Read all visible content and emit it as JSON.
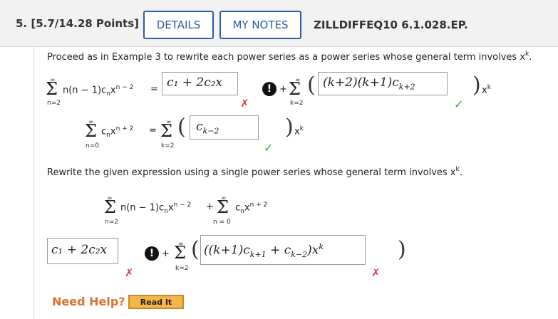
{
  "header": {
    "question_number": "5. [5.7/14.28 Points]",
    "details_label": "DETAILS",
    "my_notes_label": "MY NOTES",
    "question_code": "ZILLDIFFEQ10 6.1.028.EP."
  },
  "part1": {
    "instruction_pre": "Proceed as in Example 3 to rewrite each power series as a power series whose general term involves x",
    "instruction_sup": "k",
    "instruction_post": ".",
    "eq1": {
      "sum_upper": "∞",
      "sum_lower": "n=2",
      "term": "n(n − 1)c",
      "term_sub": "n",
      "term_x": "x",
      "term_sup": "n − 2",
      "equals": "=",
      "answer1": "c₁ + 2c₂x",
      "answer1_status": "✗",
      "plus": "+",
      "sum2_upper": "∞",
      "sum2_lower": "k=2",
      "answer2": "(k+2)(k+1)c",
      "answer2_sub": "k+2",
      "answer2_status": "✓",
      "close_term": "x",
      "close_sup": "k"
    },
    "eq2": {
      "sum_upper": "∞",
      "sum_lower": "n=0",
      "term": "c",
      "term_sub": "n",
      "term_x": "x",
      "term_sup": "n + 2",
      "equals": "=",
      "sum2_upper": "∞",
      "sum2_lower": "k=2",
      "answer": "c",
      "answer_sub": "k−2",
      "answer_status": "✓",
      "close_term": "x",
      "close_sup": "k"
    }
  },
  "part2": {
    "instruction_pre": "Rewrite the given expression using a single power series whose general term involves x",
    "instruction_sup": "k",
    "instruction_post": ".",
    "expr": {
      "sum1_upper": "∞",
      "sum1_lower": "n=2",
      "term1": "n(n − 1)c",
      "term1_sub": "n",
      "term1_x": "x",
      "term1_sup": "n − 2",
      "plus": "+",
      "sum2_upper": "∞",
      "sum2_lower": "n = 0",
      "term2": "c",
      "term2_sub": "n",
      "term2_x": "x",
      "term2_sup": "n + 2"
    },
    "answer1": "c₁ + 2c₂x",
    "answer1_status": "✗",
    "plus": "+",
    "sum_upper": "∞",
    "sum_lower": "k=2",
    "answer2": "((k+1)c",
    "answer2_sub1": "k+1",
    "answer2_mid": " + c",
    "answer2_sub2": "k−2",
    "answer2_end": ")x",
    "answer2_sup": "k",
    "answer2_status": "✗"
  },
  "footer": {
    "need_help": "Need Help?",
    "read_it": "Read It"
  },
  "colors": {
    "accent": "#2a5ca8",
    "error": "#e0393e",
    "success": "#4aa347",
    "help": "#e0702d",
    "read_it_bg": "#f5b547"
  }
}
